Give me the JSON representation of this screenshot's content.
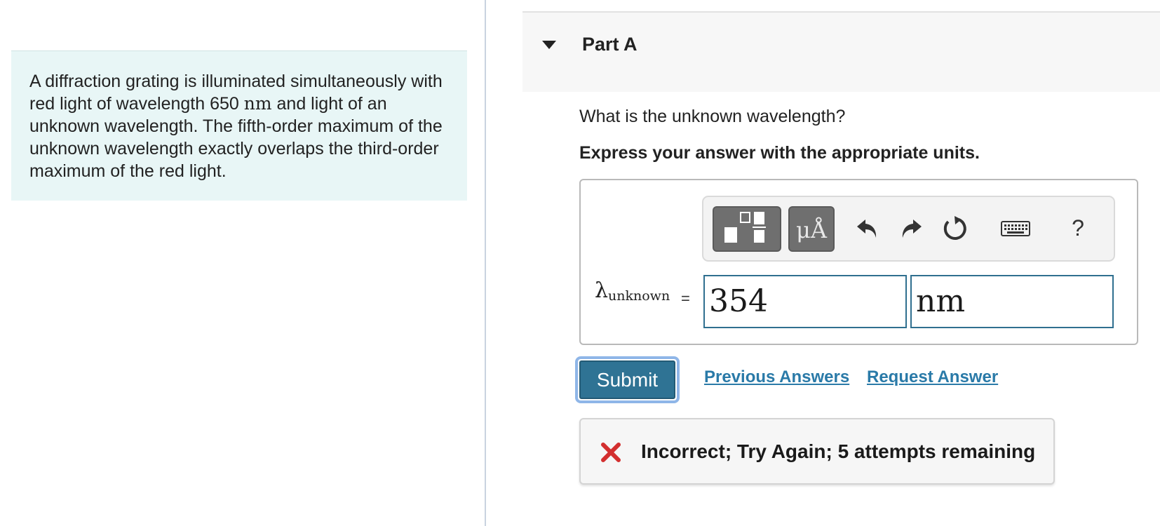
{
  "problem": {
    "text_part1": "A diffraction grating is illuminated simultaneously with red light of wavelength 650 ",
    "unit": "nm",
    "text_part2": " and light of an unknown wavelength. The fifth-order maximum of the unknown wavelength exactly overlaps the third-order maximum of the red light."
  },
  "part": {
    "title": "Part A"
  },
  "question": "What is the unknown wavelength?",
  "instruction": "Express your answer with the appropriate units.",
  "toolbar": {
    "units_label": "μÅ",
    "help_label": "?",
    "icons": [
      "templates-icon",
      "units-icon",
      "undo-icon",
      "redo-icon",
      "reset-icon",
      "keyboard-icon",
      "help-icon"
    ]
  },
  "answer": {
    "symbol": "λ",
    "subscript": "unknown",
    "equals": "=",
    "value": "354",
    "unit": "nm"
  },
  "actions": {
    "submit": "Submit",
    "previous_answers": "Previous Answers",
    "request_answer": "Request Answer"
  },
  "feedback": {
    "message": "Incorrect; Try Again; 5 attempts remaining",
    "status_color": "#d32f2f"
  },
  "colors": {
    "accent": "#2f7394",
    "link": "#2a7aa8",
    "problem_bg": "#e8f6f6"
  }
}
